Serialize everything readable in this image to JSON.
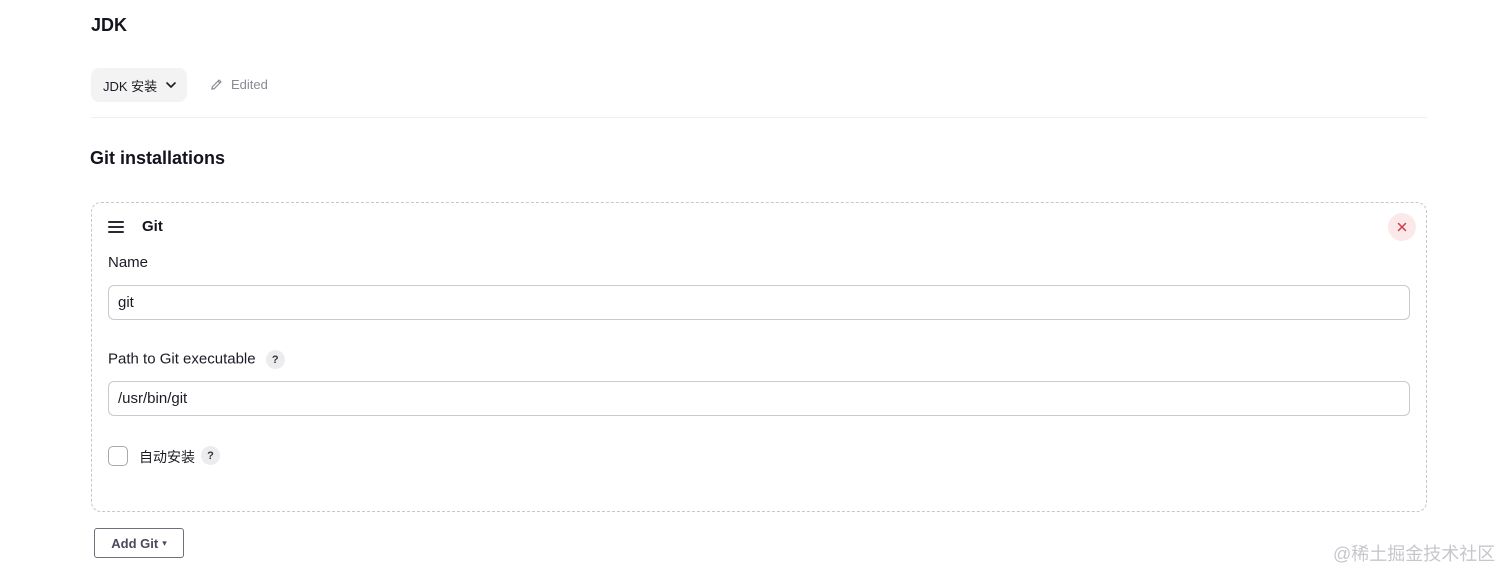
{
  "jdk": {
    "title": "JDK",
    "dropdown_label": "JDK 安装",
    "edited_label": "Edited"
  },
  "git": {
    "title": "Git installations",
    "card": {
      "title": "Git",
      "name_label": "Name",
      "name_value": "git",
      "path_label": "Path to Git executable",
      "path_value": "/usr/bin/git",
      "auto_install_label": "自动安装",
      "auto_install_checked": false,
      "help_text": "?"
    },
    "add_button_label": "Add Git"
  },
  "watermark": "@稀土掘金技术社区",
  "icons": {
    "dropdown": "chevron-down-icon",
    "edited": "pencil-icon",
    "drag": "drag-handle-icon",
    "close": "close-icon",
    "caret": "caret-down-icon"
  },
  "colors": {
    "close_bg": "#fbe9ea",
    "close_x": "#d43b45"
  }
}
